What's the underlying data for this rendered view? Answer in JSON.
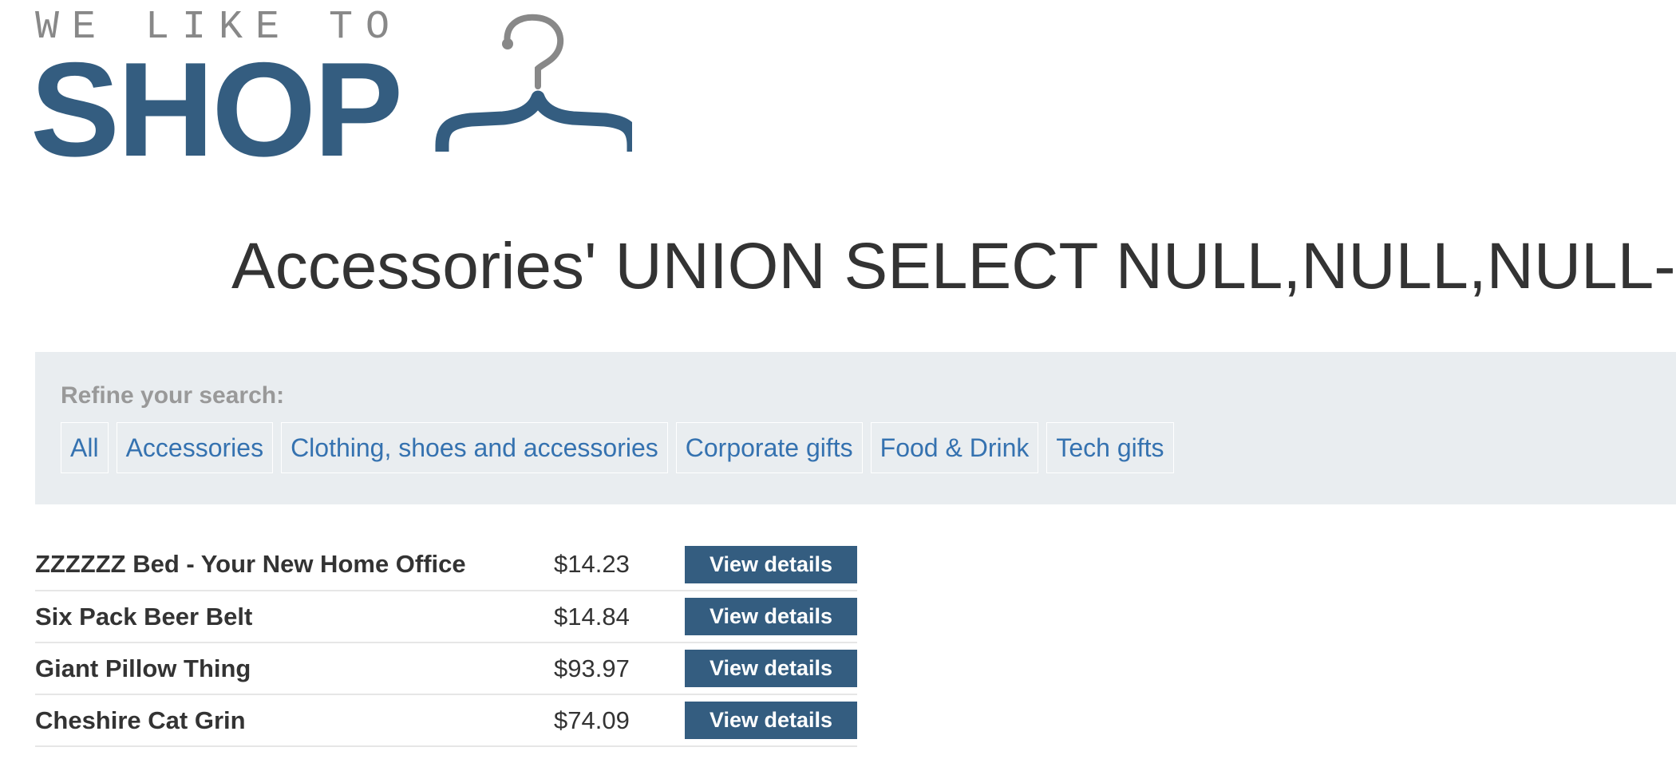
{
  "logo": {
    "tagline": "WE LIKE TO",
    "word": "SHOP",
    "icon": "hanger-icon"
  },
  "heading": "Accessories' UNION SELECT NULL,NULL,NULL--",
  "filters": {
    "label": "Refine your search:",
    "links": [
      {
        "label": "All"
      },
      {
        "label": "Accessories"
      },
      {
        "label": "Clothing, shoes and accessories"
      },
      {
        "label": "Corporate gifts"
      },
      {
        "label": "Food & Drink"
      },
      {
        "label": "Tech gifts"
      }
    ]
  },
  "products": [
    {
      "name": "ZZZZZZ Bed - Your New Home Office",
      "price": "$14.23",
      "button": "View details"
    },
    {
      "name": "Six Pack Beer Belt",
      "price": "$14.84",
      "button": "View details"
    },
    {
      "name": "Giant Pillow Thing",
      "price": "$93.97",
      "button": "View details"
    },
    {
      "name": "Cheshire Cat Grin",
      "price": "$74.09",
      "button": "View details"
    }
  ],
  "colors": {
    "brand": "#345d80",
    "link": "#3572b0",
    "panel_bg": "#e9edf0",
    "muted": "#999999"
  }
}
